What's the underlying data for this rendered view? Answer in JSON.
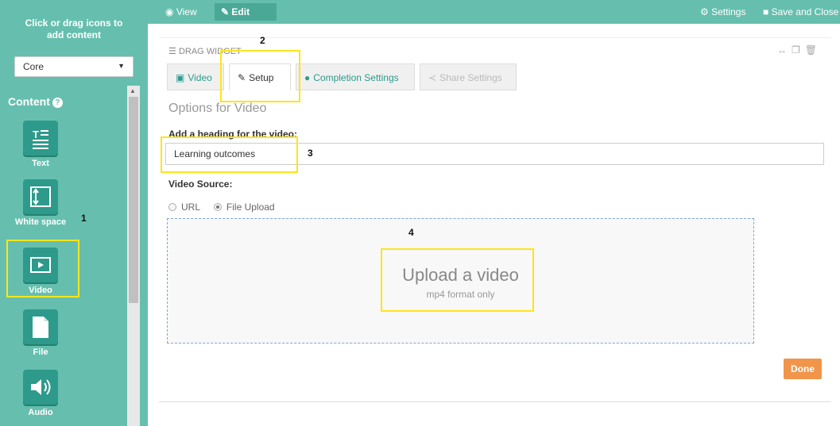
{
  "sidebar": {
    "header_line1": "Click or drag icons to",
    "header_line2": "add content",
    "select_value": "Core",
    "content_title": "Content",
    "items": [
      {
        "label": "Text",
        "icon": "text-icon"
      },
      {
        "label": "White space",
        "icon": "white-space-icon"
      },
      {
        "label": "Video",
        "icon": "video-icon"
      },
      {
        "label": "File",
        "icon": "file-icon"
      },
      {
        "label": "Audio",
        "icon": "audio-icon"
      }
    ]
  },
  "topbar": {
    "view_label": "View",
    "edit_label": "Edit",
    "settings_label": "Settings",
    "save_close_label": "Save and Close"
  },
  "widget": {
    "drag_label": "DRAG WIDGET",
    "tabs": [
      {
        "label": "Video"
      },
      {
        "label": "Setup"
      },
      {
        "label": "Completion Settings"
      },
      {
        "label": "Share Settings"
      }
    ],
    "options_title": "Options for Video",
    "heading_label": "Add a heading for the video:",
    "heading_value": "Learning outcomes",
    "source_label": "Video Source:",
    "radio_url": "URL",
    "radio_file": "File Upload",
    "upload_title": "Upload a video",
    "upload_sub": "mp4 format only",
    "done_label": "Done"
  },
  "annotations": [
    "1",
    "2",
    "3",
    "4"
  ],
  "colors": {
    "brand": "#66bfae",
    "tile": "#2d9a8b",
    "done": "#f0954a",
    "highlight": "#ffe41a"
  }
}
